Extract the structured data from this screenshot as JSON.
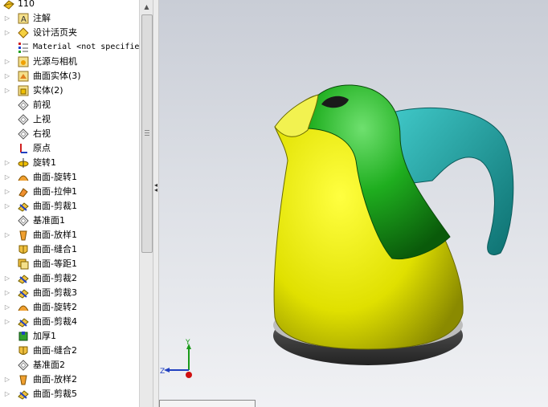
{
  "tree": {
    "root_label": "110",
    "items": [
      {
        "label": "注解",
        "icon": "annotations-icon",
        "expandable": true
      },
      {
        "label": "设计活页夹",
        "icon": "design-binder-icon",
        "expandable": true
      },
      {
        "label": "Material <not specified>",
        "icon": "material-icon",
        "expandable": false,
        "mono": true
      },
      {
        "label": "光源与相机",
        "icon": "lights-cameras-icon",
        "expandable": true
      },
      {
        "label": "曲面实体(3)",
        "icon": "surface-bodies-icon",
        "expandable": true
      },
      {
        "label": "实体(2)",
        "icon": "solid-bodies-icon",
        "expandable": true
      },
      {
        "label": "前视",
        "icon": "plane-icon",
        "expandable": false
      },
      {
        "label": "上视",
        "icon": "plane-icon",
        "expandable": false
      },
      {
        "label": "右视",
        "icon": "plane-icon",
        "expandable": false
      },
      {
        "label": "原点",
        "icon": "origin-icon",
        "expandable": false
      },
      {
        "label": "旋转1",
        "icon": "revolve-icon",
        "expandable": true
      },
      {
        "label": "曲面-旋转1",
        "icon": "surface-revolve-icon",
        "expandable": true
      },
      {
        "label": "曲面-拉伸1",
        "icon": "surface-extrude-icon",
        "expandable": true
      },
      {
        "label": "曲面-剪裁1",
        "icon": "surface-trim-icon",
        "expandable": true
      },
      {
        "label": "基准面1",
        "icon": "plane-icon",
        "expandable": false
      },
      {
        "label": "曲面-放样1",
        "icon": "surface-loft-icon",
        "expandable": true
      },
      {
        "label": "曲面-缝合1",
        "icon": "surface-knit-icon",
        "expandable": false
      },
      {
        "label": "曲面-等距1",
        "icon": "surface-offset-icon",
        "expandable": false
      },
      {
        "label": "曲面-剪裁2",
        "icon": "surface-trim-icon",
        "expandable": true
      },
      {
        "label": "曲面-剪裁3",
        "icon": "surface-trim-icon",
        "expandable": true
      },
      {
        "label": "曲面-旋转2",
        "icon": "surface-revolve-icon",
        "expandable": true
      },
      {
        "label": "曲面-剪裁4",
        "icon": "surface-trim-icon",
        "expandable": true
      },
      {
        "label": "加厚1",
        "icon": "thicken-icon",
        "expandable": false
      },
      {
        "label": "曲面-缝合2",
        "icon": "surface-knit-icon",
        "expandable": false
      },
      {
        "label": "基准面2",
        "icon": "plane-icon",
        "expandable": false
      },
      {
        "label": "曲面-放样2",
        "icon": "surface-loft-icon",
        "expandable": true
      },
      {
        "label": "曲面-剪裁5",
        "icon": "surface-trim-icon",
        "expandable": true
      }
    ]
  },
  "triad": {
    "y_label": "Y",
    "z_label": "Z"
  },
  "colors": {
    "body": "#e8e800",
    "top": "#1f9e1f",
    "handle": "#1aa3a3",
    "base": "#505050"
  }
}
